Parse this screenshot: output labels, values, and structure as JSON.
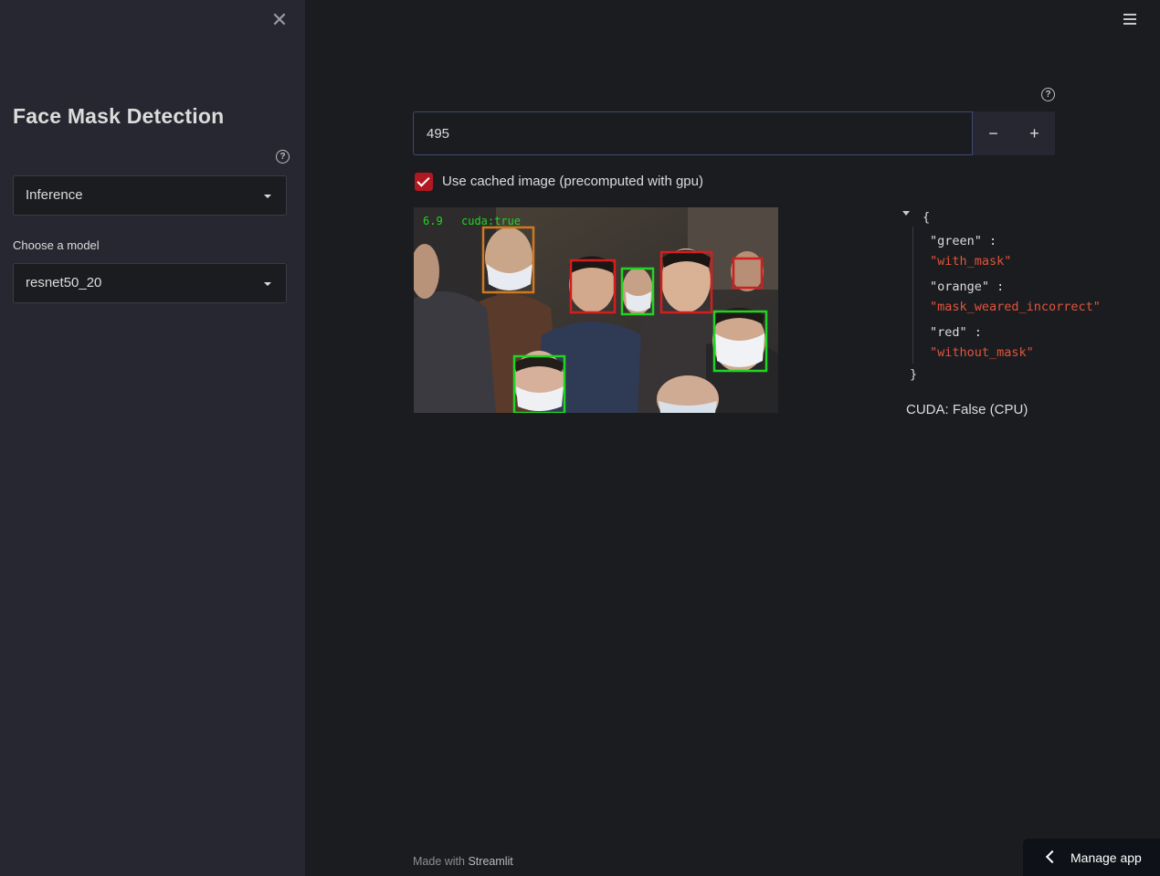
{
  "sidebar": {
    "title": "Face Mask Detection",
    "mode_select": {
      "value": "Inference"
    },
    "model_label": "Choose a model",
    "model_select": {
      "value": "resnet50_20"
    }
  },
  "main": {
    "number_input": {
      "value": "495",
      "minus": "−",
      "plus": "+"
    },
    "checkbox": {
      "label": "Use cached image (precomputed with gpu)",
      "checked": true
    },
    "image_overlay": {
      "fps_text": "6.9",
      "cuda_text": "cuda:true"
    },
    "legend_json": {
      "open": "{",
      "close": "}",
      "entries": [
        {
          "key": "\"green\" :",
          "value": "\"with_mask\""
        },
        {
          "key": "\"orange\" :",
          "value": "\"mask_weared_incorrect\""
        },
        {
          "key": "\"red\" :",
          "value": "\"without_mask\""
        }
      ]
    },
    "cuda_status": "CUDA: False (CPU)"
  },
  "footer": {
    "made_with": "Made with",
    "brand": "Streamlit"
  },
  "manage_app": {
    "label": "Manage app"
  },
  "colors": {
    "with_mask": "#22d422",
    "mask_weared_incorrect": "#d2781e",
    "without_mask": "#d41e1e",
    "accent": "#b01822"
  },
  "icons": [
    "close-icon",
    "hamburger-menu-icon",
    "help-icon",
    "chevron-down-icon",
    "check-icon",
    "chevron-left-icon"
  ]
}
